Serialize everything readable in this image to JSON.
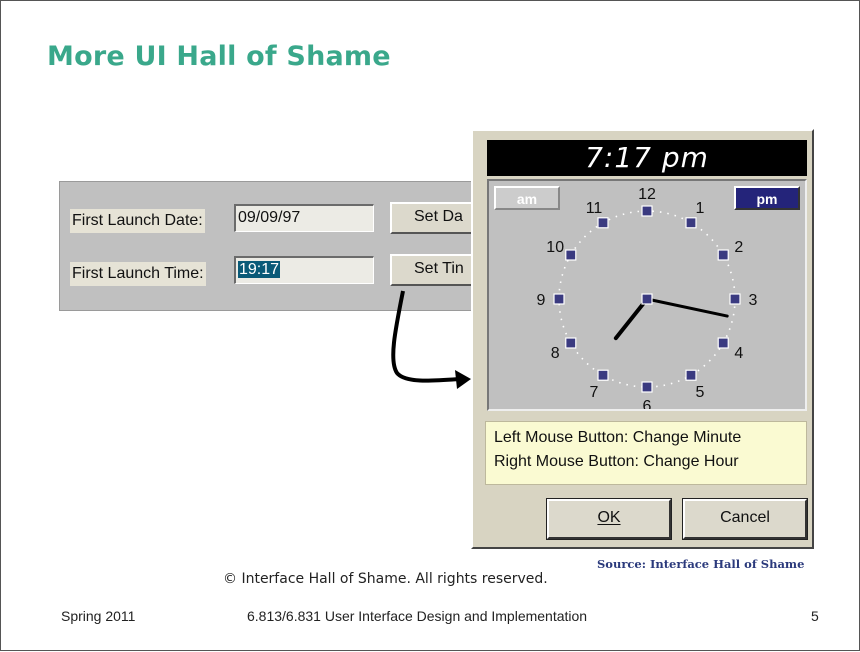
{
  "slide": {
    "title": "More UI Hall of Shame",
    "copyright": "© Interface Hall of Shame. All rights reserved.",
    "source": "Source: Interface Hall of Shame",
    "footer": {
      "term": "Spring 2011",
      "course": "6.813/6.831 User Interface Design and Implementation",
      "page": "5"
    }
  },
  "launch_form": {
    "date_label": "First Launch Date:",
    "date_value": "09/09/97",
    "date_button": "Set Da",
    "time_label": "First Launch Time:",
    "time_value": "19:17",
    "time_button": "Set Tin"
  },
  "clock_dialog": {
    "time_display": "7:17 pm",
    "am_label": "am",
    "pm_label": "pm",
    "active_period": "pm",
    "hours": [
      "12",
      "1",
      "2",
      "3",
      "4",
      "5",
      "6",
      "7",
      "8",
      "9",
      "10",
      "11"
    ],
    "hint_line1": "Left Mouse Button: Change Minute",
    "hint_line2": "Right Mouse Button: Change Hour",
    "ok_label": "OK",
    "cancel_label": "Cancel",
    "hands": {
      "hour": 7,
      "minute": 17
    }
  },
  "colors": {
    "title": "#3aa88b",
    "selection": "#0a5a78",
    "pm_button": "#24247a",
    "hint_bg": "#fafad2",
    "source_text": "#2b3a7c"
  }
}
